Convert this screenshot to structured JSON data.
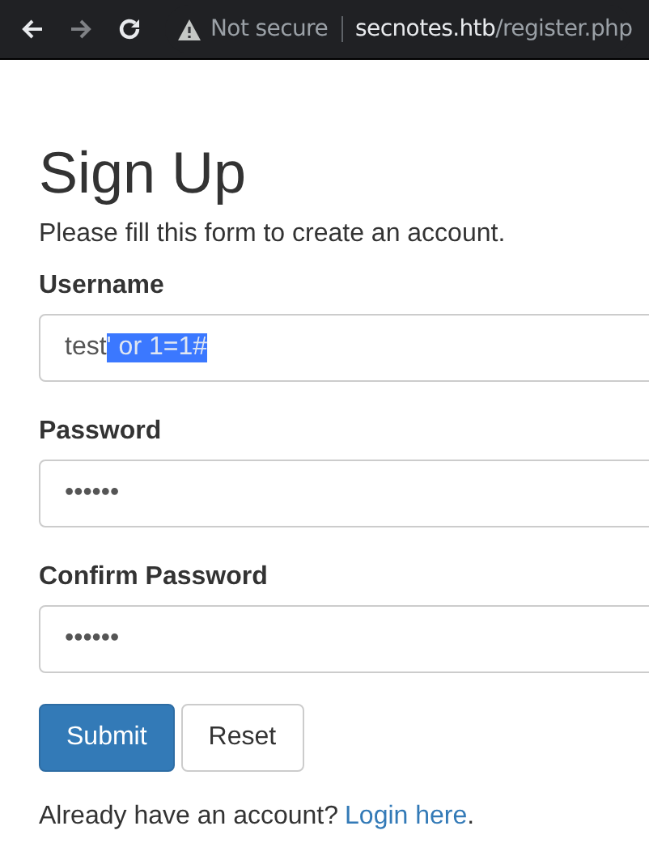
{
  "browser": {
    "security": "Not secure",
    "url_host": "secnotes.htb",
    "url_path": "/register.php"
  },
  "title": "Sign Up",
  "intro": "Please fill this form to create an account.",
  "fields": [
    {
      "label": "Username",
      "value": "test",
      "selected_value": "' or 1=1#"
    },
    {
      "label": "Password",
      "value": "••••••"
    },
    {
      "label": "Confirm Password",
      "value": "••••••"
    }
  ],
  "buttons": [
    {
      "label": "Submit",
      "kind": "primary"
    },
    {
      "label": "Reset",
      "kind": "default"
    }
  ],
  "footer": {
    "text": "Already have an account?",
    "link": "Login here",
    "end": "."
  }
}
